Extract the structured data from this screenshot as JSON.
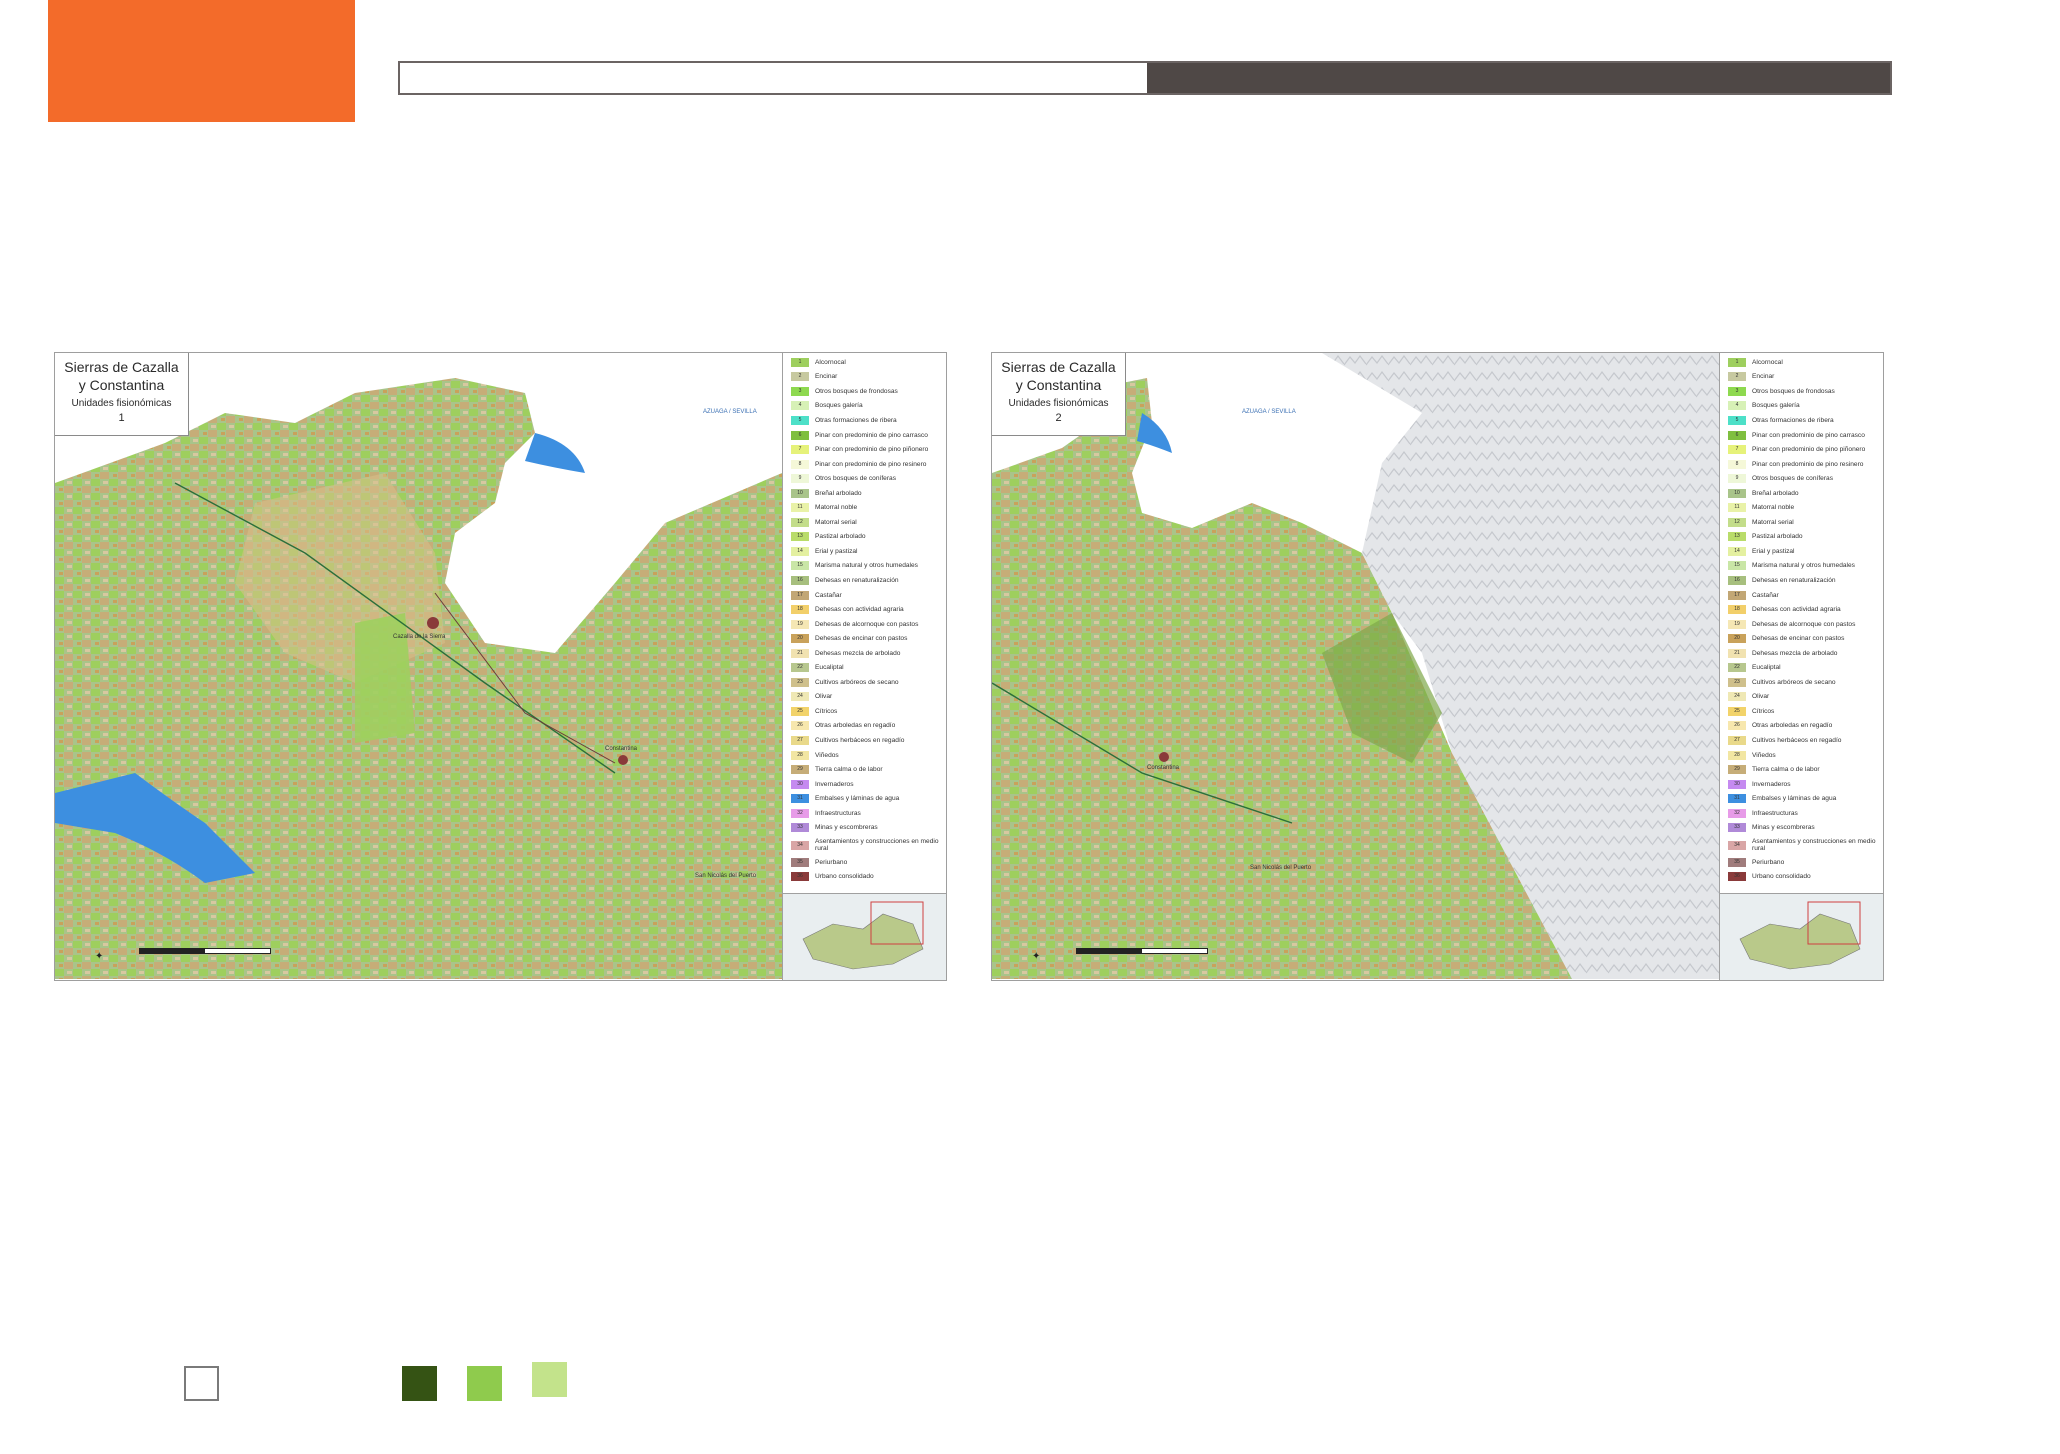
{
  "colors": {
    "accent_orange": "#f36b2a",
    "header_dark": "#4f4846",
    "key_dark_green": "#355314",
    "key_mid_green": "#8fcb4d",
    "key_light_green": "#c3e38b"
  },
  "maps": [
    {
      "title_line1": "Sierras de Cazalla",
      "title_line2": "y Constantina",
      "subtitle": "Unidades fisionómicas",
      "number": "1",
      "place_labels": [
        "San Nicolás del Puerto",
        "Constantina",
        "Cazalla de la Sierra",
        "AZUAGA / SEVILLA"
      ]
    },
    {
      "title_line1": "Sierras de Cazalla",
      "title_line2": "y Constantina",
      "subtitle": "Unidades fisionómicas",
      "number": "2",
      "place_labels": [
        "San Nicolás del Puerto",
        "Constantina",
        "AZUAGA / SEVILLA"
      ]
    }
  ],
  "legend": [
    {
      "code": "1",
      "label": "Alcornocal",
      "color": "#9ecf5e"
    },
    {
      "code": "2",
      "label": "Encinar",
      "color": "#c7c9a0"
    },
    {
      "code": "3",
      "label": "Otros bosques de frondosas",
      "color": "#8ed94f"
    },
    {
      "code": "4",
      "label": "Bosques galería",
      "color": "#d7f1b6"
    },
    {
      "code": "5",
      "label": "Otras formaciones de ribera",
      "color": "#4de0c8"
    },
    {
      "code": "6",
      "label": "Pinar con predominio de pino carrasco",
      "color": "#7fbf3f"
    },
    {
      "code": "7",
      "label": "Pinar con predominio de pino piñonero",
      "color": "#e6f27a"
    },
    {
      "code": "8",
      "label": "Pinar con predominio de pino resinero",
      "color": "#f5f8d8"
    },
    {
      "code": "9",
      "label": "Otros bosques de coníferas",
      "color": "#eef7d8"
    },
    {
      "code": "10",
      "label": "Breñal arbolado",
      "color": "#a9c48a"
    },
    {
      "code": "11",
      "label": "Matorral noble",
      "color": "#e9f2a8"
    },
    {
      "code": "12",
      "label": "Matorral serial",
      "color": "#c3dd8a"
    },
    {
      "code": "13",
      "label": "Pastizal arbolado",
      "color": "#b9dc6a"
    },
    {
      "code": "14",
      "label": "Erial y pastizal",
      "color": "#e4f0a0"
    },
    {
      "code": "15",
      "label": "Marisma natural y otros humedales",
      "color": "#c9e6a6"
    },
    {
      "code": "16",
      "label": "Dehesas en renaturalización",
      "color": "#a7bf7e"
    },
    {
      "code": "17",
      "label": "Castañar",
      "color": "#c2a775"
    },
    {
      "code": "18",
      "label": "Dehesas con actividad agraria",
      "color": "#f2cf6a"
    },
    {
      "code": "19",
      "label": "Dehesas de alcornoque con pastos",
      "color": "#f5e7b4"
    },
    {
      "code": "20",
      "label": "Dehesas de encinar con pastos",
      "color": "#c9a25b"
    },
    {
      "code": "21",
      "label": "Dehesas mezcla de arbolado",
      "color": "#f1e2b0"
    },
    {
      "code": "22",
      "label": "Eucaliptal",
      "color": "#b7c78e"
    },
    {
      "code": "23",
      "label": "Cultivos arbóreos de secano",
      "color": "#cfc08c"
    },
    {
      "code": "24",
      "label": "Olivar",
      "color": "#efe8b4"
    },
    {
      "code": "25",
      "label": "Cítricos",
      "color": "#f2d36a"
    },
    {
      "code": "26",
      "label": "Otras arboledas en regadío",
      "color": "#f7e7ad"
    },
    {
      "code": "27",
      "label": "Cultivos herbáceos en regadío",
      "color": "#e9d98a"
    },
    {
      "code": "28",
      "label": "Viñedos",
      "color": "#f2e6a2"
    },
    {
      "code": "29",
      "label": "Tierra calma o de labor",
      "color": "#c6ad78"
    },
    {
      "code": "30",
      "label": "Invernaderos",
      "color": "#c58af0"
    },
    {
      "code": "31",
      "label": "Embalses y láminas de agua",
      "color": "#3d8fe0"
    },
    {
      "code": "32",
      "label": "Infraestructuras",
      "color": "#e79be8"
    },
    {
      "code": "33",
      "label": "Minas y escombreras",
      "color": "#b08ad8"
    },
    {
      "code": "34",
      "label": "Asentamientos y construcciones en medio rural",
      "color": "#d9a6a6"
    },
    {
      "code": "35",
      "label": "Periurbano",
      "color": "#a07c7c"
    },
    {
      "code": "36",
      "label": "Urbano consolidado",
      "color": "#8a3a3a"
    }
  ]
}
